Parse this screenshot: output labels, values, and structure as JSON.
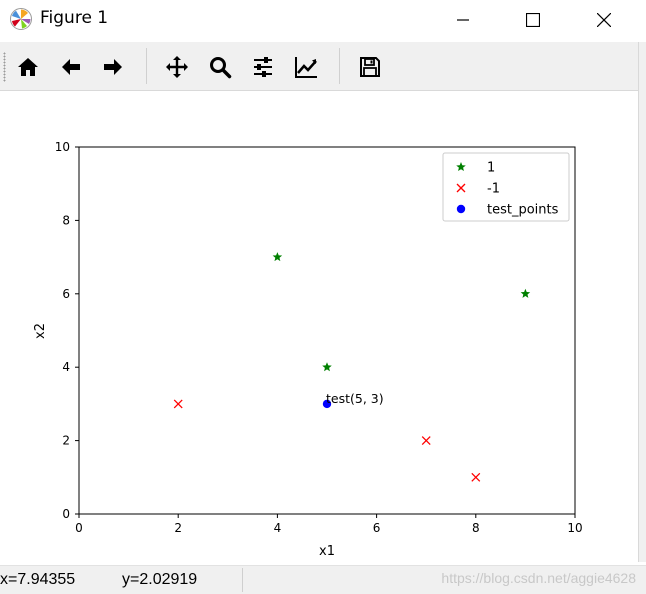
{
  "window": {
    "title": "Figure 1",
    "icon": "matplotlib-logo-icon",
    "controls": [
      "minimize-icon",
      "maximize-icon",
      "close-icon"
    ]
  },
  "toolbar": {
    "buttons": [
      {
        "name": "home",
        "icon": "home-icon"
      },
      {
        "name": "back",
        "icon": "arrow-left-icon"
      },
      {
        "name": "forward",
        "icon": "arrow-right-icon"
      },
      {
        "name": "pan",
        "icon": "move-icon"
      },
      {
        "name": "zoom",
        "icon": "magnifier-icon"
      },
      {
        "name": "configure-subplots",
        "icon": "sliders-icon"
      },
      {
        "name": "edit-axis",
        "icon": "line-chart-icon"
      },
      {
        "name": "save",
        "icon": "floppy-disk-icon"
      }
    ]
  },
  "chart_data": {
    "type": "scatter",
    "xlabel": "x1",
    "ylabel": "x2",
    "xlim": [
      0,
      10
    ],
    "ylim": [
      0,
      10
    ],
    "xticks": [
      "0",
      "2",
      "4",
      "6",
      "8",
      "10"
    ],
    "yticks": [
      "0",
      "2",
      "4",
      "6",
      "8",
      "10"
    ],
    "grid": false,
    "legend_position": "top-right",
    "series": [
      {
        "name": "1",
        "marker": "star",
        "color": "#008000",
        "points": [
          [
            4,
            7
          ],
          [
            5,
            4
          ],
          [
            9,
            6
          ]
        ]
      },
      {
        "name": "-1",
        "marker": "x",
        "color": "#ff0000",
        "points": [
          [
            2,
            3
          ],
          [
            7,
            2
          ],
          [
            8,
            1
          ]
        ]
      },
      {
        "name": "test_points",
        "marker": "circle",
        "color": "#0000ff",
        "points": [
          [
            5,
            3
          ]
        ]
      }
    ],
    "annotations": [
      {
        "text": "test(5, 3)",
        "x": 5,
        "y": 3
      }
    ]
  },
  "status": {
    "x_readout": "x=7.94355",
    "y_readout": "y=2.02919",
    "watermark": "https://blog.csdn.net/aggie4628"
  }
}
